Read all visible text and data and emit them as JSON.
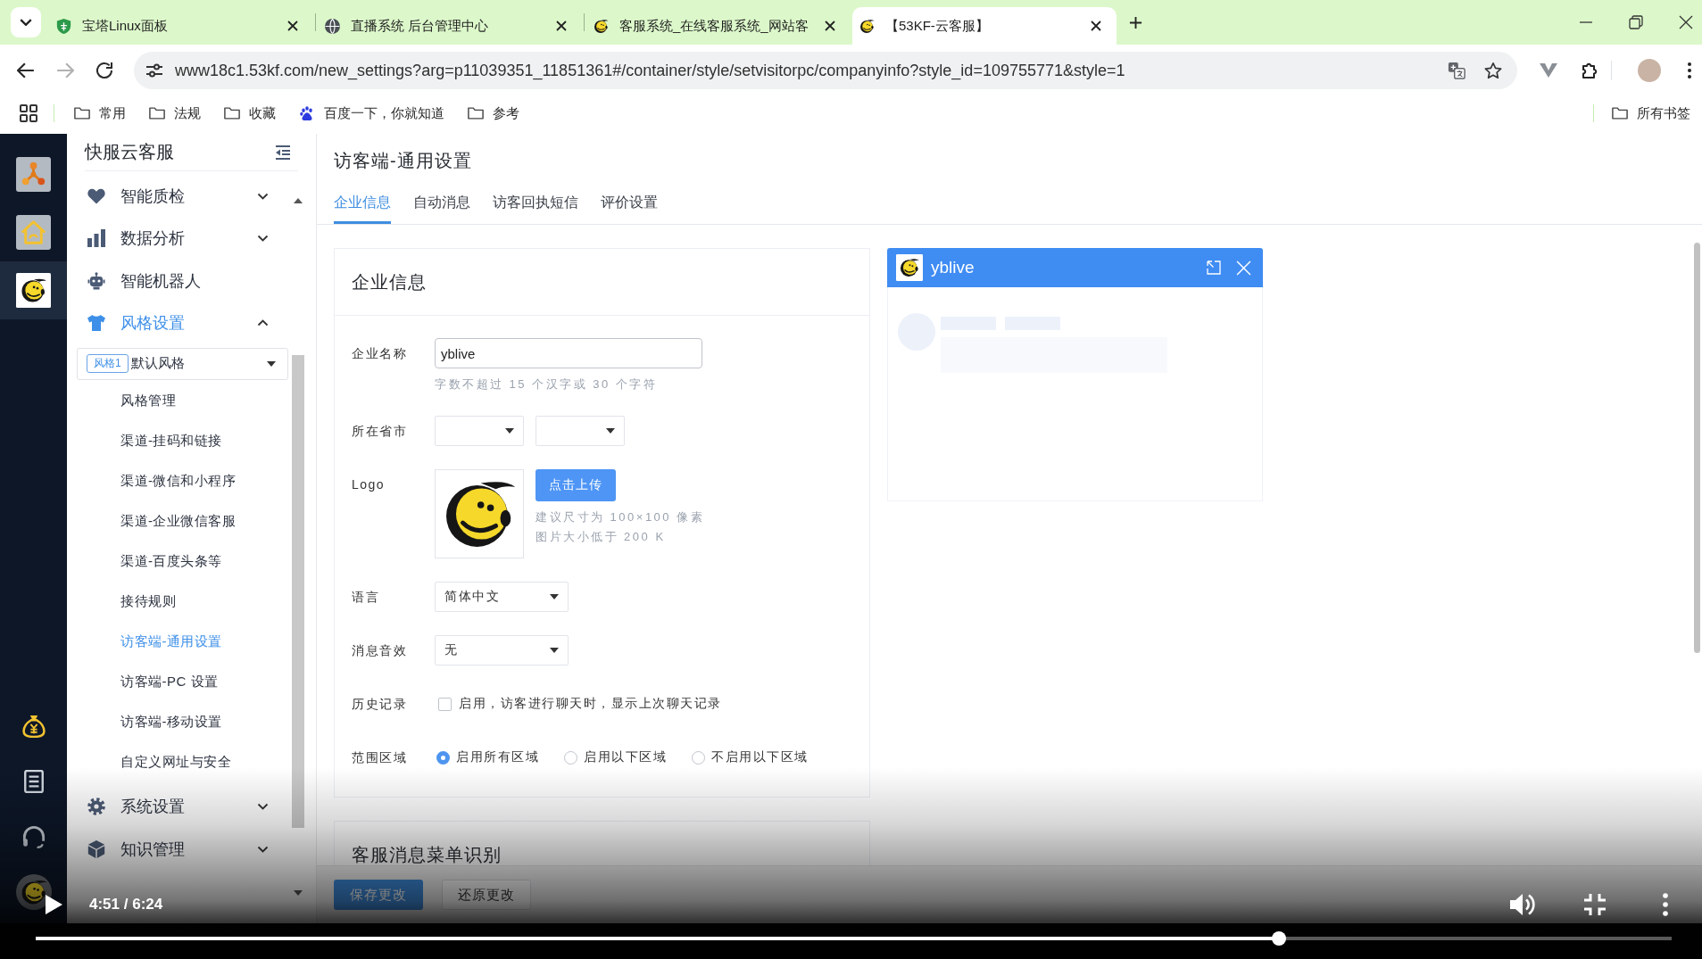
{
  "browser": {
    "tabs": [
      {
        "title": "宝塔Linux面板",
        "selected": false
      },
      {
        "title": "直播系统 后台管理中心",
        "selected": false
      },
      {
        "title": "客服系统_在线客服系统_网站客",
        "selected": false
      },
      {
        "title": "【53KF-云客服】",
        "selected": true
      }
    ],
    "url": "www18c1.53kf.com/new_settings?arg=p11039351_11851361#/container/style/setvisitorpc/companyinfo?style_id=109755771&style=1",
    "bookmarks": [
      {
        "label": "常用",
        "kind": "folder"
      },
      {
        "label": "法规",
        "kind": "folder"
      },
      {
        "label": "收藏",
        "kind": "folder"
      },
      {
        "label": "百度一下，你就知道",
        "kind": "site"
      },
      {
        "label": "参考",
        "kind": "folder"
      }
    ],
    "all_bookmarks": "所有书签"
  },
  "rail": {
    "items": [
      {
        "selected": false
      },
      {
        "selected": false
      },
      {
        "selected": true
      }
    ]
  },
  "sidebar": {
    "title": "快服云客服",
    "items": [
      {
        "label": "智能质检",
        "selected": false,
        "expanded": false
      },
      {
        "label": "数据分析",
        "selected": false,
        "expanded": false
      },
      {
        "label": "智能机器人",
        "selected": false
      },
      {
        "label": "风格设置",
        "selected": true,
        "expanded": true,
        "style_select": {
          "tag": "风格1",
          "name": "默认风格"
        },
        "children": [
          {
            "label": "风格管理",
            "selected": false
          },
          {
            "label": "渠道-挂码和链接",
            "selected": false
          },
          {
            "label": "渠道-微信和小程序",
            "selected": false
          },
          {
            "label": "渠道-企业微信客服",
            "selected": false
          },
          {
            "label": "渠道-百度头条等",
            "selected": false
          },
          {
            "label": "接待规则",
            "selected": false
          },
          {
            "label": "访客端-通用设置",
            "selected": true
          },
          {
            "label": "访客端-PC 设置",
            "selected": false
          },
          {
            "label": "访客端-移动设置",
            "selected": false
          },
          {
            "label": "自定义网址与安全",
            "selected": false
          }
        ]
      },
      {
        "label": "系统设置",
        "selected": false,
        "expanded": false
      },
      {
        "label": "知识管理",
        "selected": false,
        "expanded": false
      }
    ]
  },
  "page": {
    "title": "访客端-通用设置",
    "tabs": [
      {
        "label": "企业信息",
        "selected": true
      },
      {
        "label": "自动消息",
        "selected": false
      },
      {
        "label": "访客回执短信",
        "selected": false
      },
      {
        "label": "评价设置",
        "selected": false
      }
    ],
    "card": {
      "title": "企业信息",
      "fields": [
        {
          "kind": "text",
          "label": "企业名称",
          "value": "yblive",
          "hint": "字数不超过 15 个汉字或 30 个字符"
        },
        {
          "kind": "region",
          "label": "所在省市"
        },
        {
          "kind": "upload",
          "label": "Logo",
          "button": "点击上传",
          "hints": [
            "建议尺寸为 100×100 像素",
            "图片大小低于 200 K"
          ]
        },
        {
          "kind": "select",
          "label": "语言",
          "value": "简体中文"
        },
        {
          "kind": "select",
          "label": "消息音效",
          "value": "无"
        },
        {
          "kind": "checkbox",
          "label": "历史记录",
          "text": "启用，访客进行聊天时，显示上次聊天记录",
          "checked": false
        },
        {
          "kind": "radio",
          "label": "范围区域",
          "options": [
            {
              "label": "启用所有区域",
              "selected": true
            },
            {
              "label": "启用以下区域",
              "selected": false
            },
            {
              "label": "不启用以下区域",
              "selected": false
            }
          ]
        }
      ]
    },
    "next_card": {
      "title": "客服消息菜单识别"
    },
    "buttons": [
      {
        "label": "保存更改",
        "kind": "primary"
      },
      {
        "label": "还原更改",
        "kind": "default"
      }
    ]
  },
  "preview": {
    "title": "yblive"
  },
  "video": {
    "playing": false,
    "time": "4:51 / 6:24",
    "level": 0.76
  }
}
